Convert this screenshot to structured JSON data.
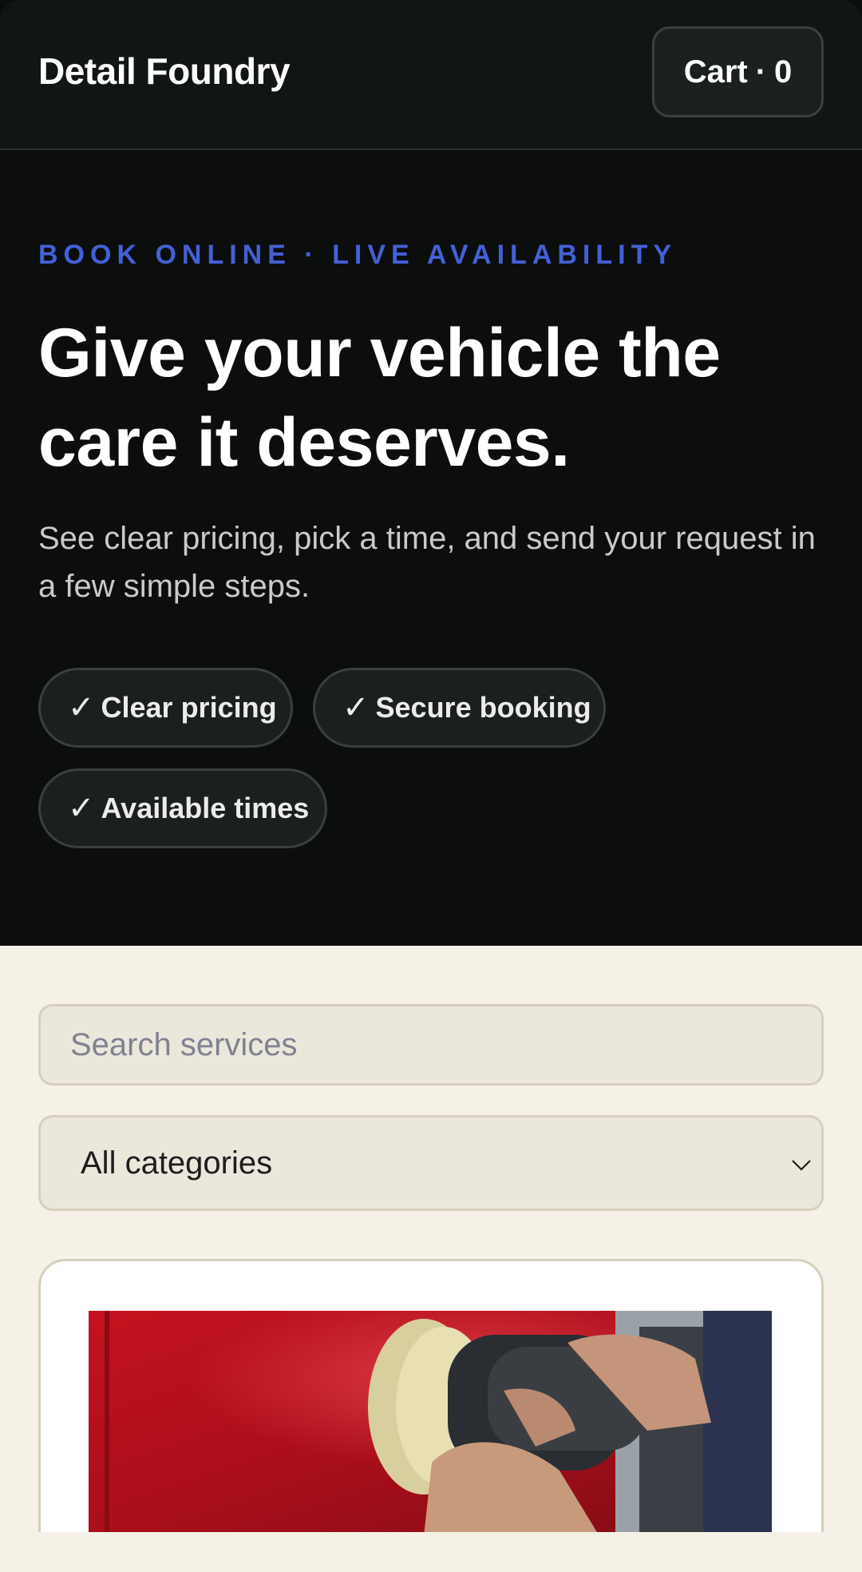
{
  "header": {
    "brand": "Detail Foundry",
    "cart_label": "Cart",
    "cart_separator": "·",
    "cart_count": "0"
  },
  "hero": {
    "eyebrow": "BOOK ONLINE · LIVE AVAILABILITY",
    "headline": "Give your vehicle the care it deserves.",
    "subtext": "See clear pricing, pick a time, and send your request in a few simple steps.",
    "badges": [
      {
        "check": "✓",
        "label": "Clear pricing"
      },
      {
        "check": "✓",
        "label": "Secure booking"
      },
      {
        "check": "✓",
        "label": "Available times"
      }
    ]
  },
  "filters": {
    "search_placeholder": "Search services",
    "search_value": "",
    "category_selected": "All categories"
  },
  "colors": {
    "accent": "#4460d8",
    "hero_bg": "#0b0e0c",
    "content_bg": "#f5f1e6"
  },
  "icons": {
    "check": "check-icon",
    "dropdown": "chevron-down-icon"
  }
}
